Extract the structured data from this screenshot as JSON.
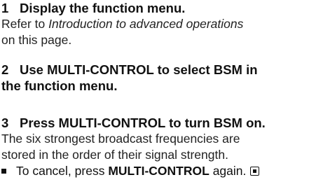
{
  "steps": [
    {
      "number": "1",
      "heading": "Display the function menu.",
      "body_prefix": "Refer to ",
      "body_italic": "Introduction to advanced operations",
      "body_suffix": "on this page."
    },
    {
      "number": "2",
      "heading_line1": "Use MULTI-CONTROL to select BSM in",
      "heading_line2": "the function menu."
    },
    {
      "number": "3",
      "heading": "Press MULTI-CONTROL to turn BSM on.",
      "body_line1": "The six strongest broadcast frequencies are",
      "body_line2": "stored in the order of their signal strength.",
      "bullet_prefix": "To cancel, press ",
      "bullet_bold": "MULTI-CONTROL",
      "bullet_suffix": " again."
    }
  ]
}
